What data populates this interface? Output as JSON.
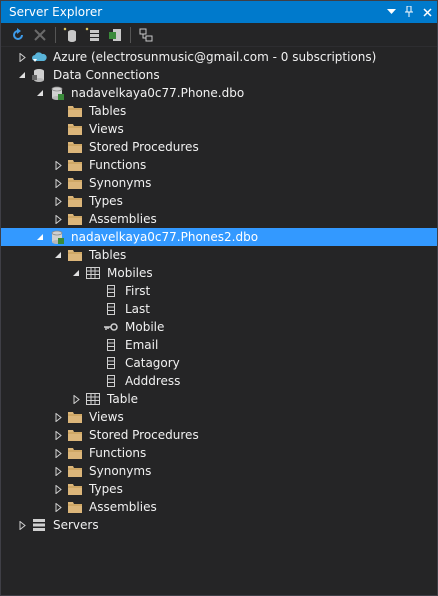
{
  "window": {
    "title": "Server Explorer"
  },
  "title_controls": [
    "▾",
    "ᵖ",
    "✕"
  ],
  "toolbar": {
    "buttons": [
      {
        "name": "refresh-button"
      },
      {
        "name": "stop-button"
      },
      {
        "name": "connect-to-database-button"
      },
      {
        "name": "connect-to-server-button"
      },
      {
        "name": "connect-to-sharepoint-button"
      },
      {
        "name": "properties-button"
      }
    ]
  },
  "tree": [
    {
      "label": "Azure (electrosunmusic@gmail.com - 0 subscriptions)",
      "depth": 0,
      "state": "collapsed",
      "icon": "azure-icon"
    },
    {
      "label": "Data Connections",
      "depth": 0,
      "state": "expanded",
      "icon": "data-connections-icon"
    },
    {
      "label": "nadavelkaya0c77.Phone.dbo",
      "depth": 1,
      "state": "expanded",
      "icon": "database-icon"
    },
    {
      "label": "Tables",
      "depth": 2,
      "state": "none",
      "icon": "folder-icon"
    },
    {
      "label": "Views",
      "depth": 2,
      "state": "none",
      "icon": "folder-icon"
    },
    {
      "label": "Stored Procedures",
      "depth": 2,
      "state": "none",
      "icon": "folder-icon"
    },
    {
      "label": "Functions",
      "depth": 2,
      "state": "collapsed",
      "icon": "folder-icon"
    },
    {
      "label": "Synonyms",
      "depth": 2,
      "state": "collapsed",
      "icon": "folder-icon"
    },
    {
      "label": "Types",
      "depth": 2,
      "state": "collapsed",
      "icon": "folder-icon"
    },
    {
      "label": "Assemblies",
      "depth": 2,
      "state": "collapsed",
      "icon": "folder-icon"
    },
    {
      "label": "nadavelkaya0c77.Phones2.dbo",
      "depth": 1,
      "state": "expanded",
      "icon": "database-icon",
      "selected": true
    },
    {
      "label": "Tables",
      "depth": 2,
      "state": "expanded",
      "icon": "folder-icon"
    },
    {
      "label": "Mobiles",
      "depth": 3,
      "state": "expanded",
      "icon": "table-icon"
    },
    {
      "label": "First",
      "depth": 4,
      "state": "none",
      "icon": "column-icon"
    },
    {
      "label": "Last",
      "depth": 4,
      "state": "none",
      "icon": "column-icon"
    },
    {
      "label": "Mobile",
      "depth": 4,
      "state": "none",
      "icon": "key-column-icon"
    },
    {
      "label": "Email",
      "depth": 4,
      "state": "none",
      "icon": "column-icon"
    },
    {
      "label": "Catagory",
      "depth": 4,
      "state": "none",
      "icon": "column-icon"
    },
    {
      "label": "Adddress",
      "depth": 4,
      "state": "none",
      "icon": "column-icon"
    },
    {
      "label": "Table",
      "depth": 3,
      "state": "collapsed",
      "icon": "table-icon"
    },
    {
      "label": "Views",
      "depth": 2,
      "state": "collapsed",
      "icon": "folder-icon"
    },
    {
      "label": "Stored Procedures",
      "depth": 2,
      "state": "collapsed",
      "icon": "folder-icon"
    },
    {
      "label": "Functions",
      "depth": 2,
      "state": "collapsed",
      "icon": "folder-icon"
    },
    {
      "label": "Synonyms",
      "depth": 2,
      "state": "collapsed",
      "icon": "folder-icon"
    },
    {
      "label": "Types",
      "depth": 2,
      "state": "collapsed",
      "icon": "folder-icon"
    },
    {
      "label": "Assemblies",
      "depth": 2,
      "state": "collapsed",
      "icon": "folder-icon"
    },
    {
      "label": "Servers",
      "depth": 0,
      "state": "collapsed",
      "icon": "servers-icon"
    }
  ],
  "colors": {
    "accent": "#007acc",
    "selection": "#3399ff",
    "background": "#252526",
    "folder": "#dcb67a",
    "text": "#f1f1f1"
  }
}
